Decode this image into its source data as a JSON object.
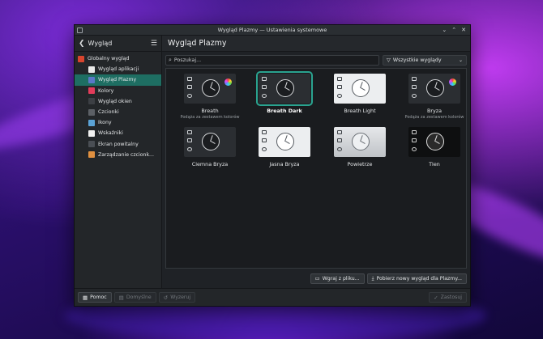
{
  "window": {
    "title": "Wygląd Plazmy — Ustawienia systemowe"
  },
  "sidebar": {
    "header": "Wygląd",
    "items": [
      {
        "label": "Globalny wygląd",
        "icon": "globe-icon",
        "sub": false,
        "active": false,
        "color": "#d8452e"
      },
      {
        "label": "Wygląd aplikacji",
        "icon": "brush-icon",
        "sub": true,
        "active": false,
        "color": "#e8e8e8"
      },
      {
        "label": "Wygląd Plazmy",
        "icon": "plasma-icon",
        "sub": true,
        "active": true,
        "color": "#5a78c8"
      },
      {
        "label": "Kolory",
        "icon": "palette-icon",
        "sub": true,
        "active": false,
        "color": "#e23b5a"
      },
      {
        "label": "Wygląd okien",
        "icon": "window-icon",
        "sub": true,
        "active": false,
        "color": "#3c3f44"
      },
      {
        "label": "Czcionki",
        "icon": "font-icon",
        "sub": true,
        "active": false,
        "color": "#5c6066"
      },
      {
        "label": "Ikony",
        "icon": "icons-icon",
        "sub": true,
        "active": false,
        "color": "#5ba3d6"
      },
      {
        "label": "Wskaźniki",
        "icon": "cursor-icon",
        "sub": true,
        "active": false,
        "color": "#f0f0f0"
      },
      {
        "label": "Ekran powitalny",
        "icon": "splash-icon",
        "sub": true,
        "active": false,
        "color": "#4a4e54"
      },
      {
        "label": "Zarządzanie czcionk...",
        "icon": "font-manager-icon",
        "sub": true,
        "active": false,
        "color": "#e09040"
      }
    ]
  },
  "main": {
    "title": "Wygląd Plazmy",
    "search_placeholder": "Poszukaj...",
    "filter": "Wszystkie wyglądy",
    "themes": [
      {
        "name": "Breath",
        "subtitle": "Podąża za zestawem kolorów",
        "style": "dark",
        "selected": false,
        "wheel": true
      },
      {
        "name": "Breath Dark",
        "subtitle": "",
        "style": "dark",
        "selected": true,
        "wheel": false
      },
      {
        "name": "Breath Light",
        "subtitle": "",
        "style": "light",
        "selected": false,
        "wheel": false
      },
      {
        "name": "Bryza",
        "subtitle": "Podąża za zestawem kolorów",
        "style": "dark",
        "selected": false,
        "wheel": true
      },
      {
        "name": "Ciemna Bryza",
        "subtitle": "",
        "style": "dark",
        "selected": false,
        "wheel": false
      },
      {
        "name": "Jasna Bryza",
        "subtitle": "",
        "style": "light",
        "selected": false,
        "wheel": false
      },
      {
        "name": "Powietrze",
        "subtitle": "",
        "style": "grey",
        "selected": false,
        "wheel": false
      },
      {
        "name": "Tlen",
        "subtitle": "",
        "style": "black",
        "selected": false,
        "wheel": false
      }
    ],
    "install_file": "Wgraj z pliku...",
    "get_new": "Pobierz nowy wygląd dla Plazmy..."
  },
  "footer": {
    "help": "Pomoc",
    "defaults": "Domyślne",
    "reset": "Wyzeruj",
    "apply": "Zastosuj"
  }
}
